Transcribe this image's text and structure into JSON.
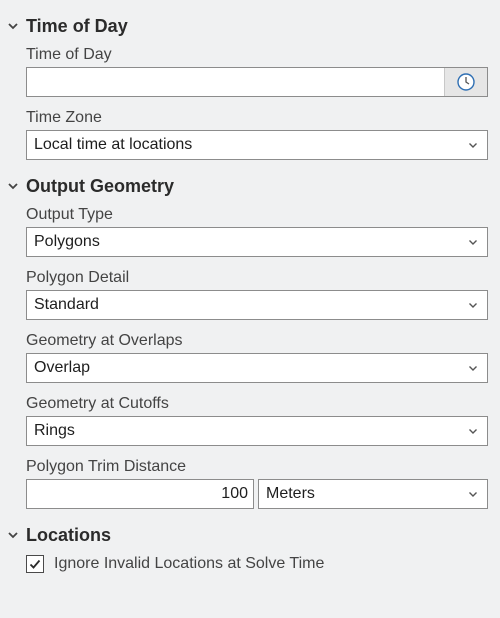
{
  "sections": {
    "time_of_day": {
      "title": "Time of Day",
      "time_of_day_label": "Time of Day",
      "time_of_day_value": "",
      "time_zone_label": "Time Zone",
      "time_zone_value": "Local time at locations"
    },
    "output_geometry": {
      "title": "Output Geometry",
      "output_type_label": "Output Type",
      "output_type_value": "Polygons",
      "polygon_detail_label": "Polygon Detail",
      "polygon_detail_value": "Standard",
      "geometry_at_overlaps_label": "Geometry at Overlaps",
      "geometry_at_overlaps_value": "Overlap",
      "geometry_at_cutoffs_label": "Geometry at Cutoffs",
      "geometry_at_cutoffs_value": "Rings",
      "polygon_trim_distance_label": "Polygon Trim Distance",
      "polygon_trim_distance_value": "100",
      "polygon_trim_distance_unit": "Meters"
    },
    "locations": {
      "title": "Locations",
      "ignore_invalid_label": "Ignore Invalid Locations at Solve Time",
      "ignore_invalid_checked": true
    }
  },
  "icons": {
    "section_toggle": "chevron-down-icon",
    "dropdown": "chevron-down-icon",
    "time_picker": "clock-icon",
    "checkbox": "checkmark-icon"
  },
  "colors": {
    "background": "#f0f1f2",
    "field_border": "#8c8c8c",
    "clock_accent": "#2f6fb3"
  }
}
